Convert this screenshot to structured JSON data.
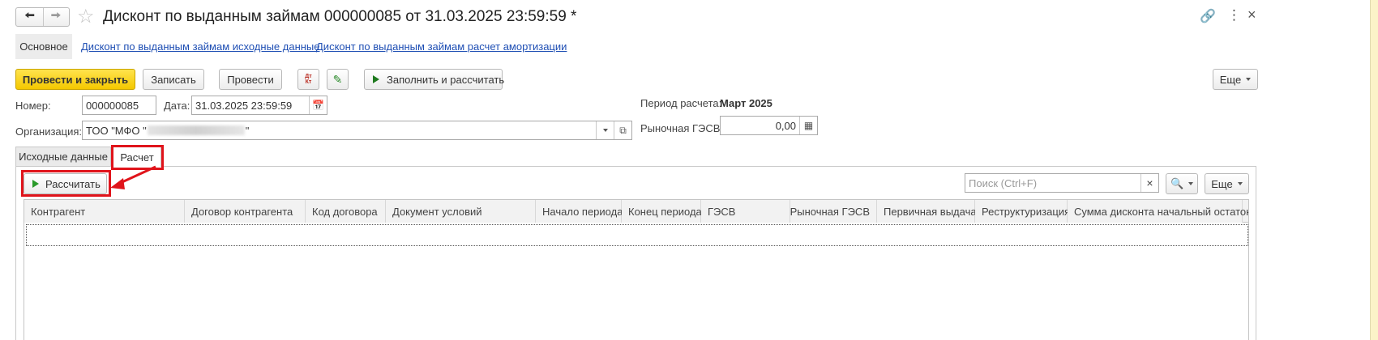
{
  "window": {
    "title": "Дисконт по выданным займам 000000085 от 31.03.2025 23:59:59 *"
  },
  "nav_tabs": [
    {
      "label": "Основное",
      "active": true
    },
    {
      "label": "Дисконт по выданным займам исходные данные"
    },
    {
      "label": "Дисконт по выданным займам расчет амортизации"
    }
  ],
  "toolbar": {
    "post_close_label": "Провести и закрыть",
    "save_label": "Записать",
    "post_label": "Провести",
    "dtkt_icon_label": "Дт Кт",
    "fill_calc_label": "Заполнить и рассчитать",
    "more_label": "Еще"
  },
  "form": {
    "number_label": "Номер:",
    "number_value": "000000085",
    "date_label": "Дата:",
    "date_value": "31.03.2025 23:59:59",
    "org_label": "Организация:",
    "org_value": "ТОО \"МФО \"",
    "org_value_end": "\"",
    "period_label": "Период расчета:",
    "period_value": "Март 2025",
    "market_rate_label": "Рыночная ГЭСВ:",
    "market_rate_value": "0,00"
  },
  "section_tabs": [
    {
      "label": "Исходные данные"
    },
    {
      "label": "Расчет",
      "active": true
    }
  ],
  "calc": {
    "calculate_label": "Рассчитать",
    "search_placeholder": "Поиск (Ctrl+F)",
    "search_clear": "×",
    "more_label": "Еще"
  },
  "table": {
    "columns": [
      "Контрагент",
      "Договор контрагента",
      "Код договора",
      "Документ условий",
      "Начало периода",
      "Конец периода",
      "ГЭСВ",
      "Рыночная ГЭСВ",
      "Первичная выдача",
      "Реструктуризация",
      "Сумма дисконта начальный остаток"
    ]
  },
  "colors": {
    "accent_yellow": "#f4c800",
    "link_blue": "#1f4fb4",
    "annotation_red": "#e0141b"
  }
}
